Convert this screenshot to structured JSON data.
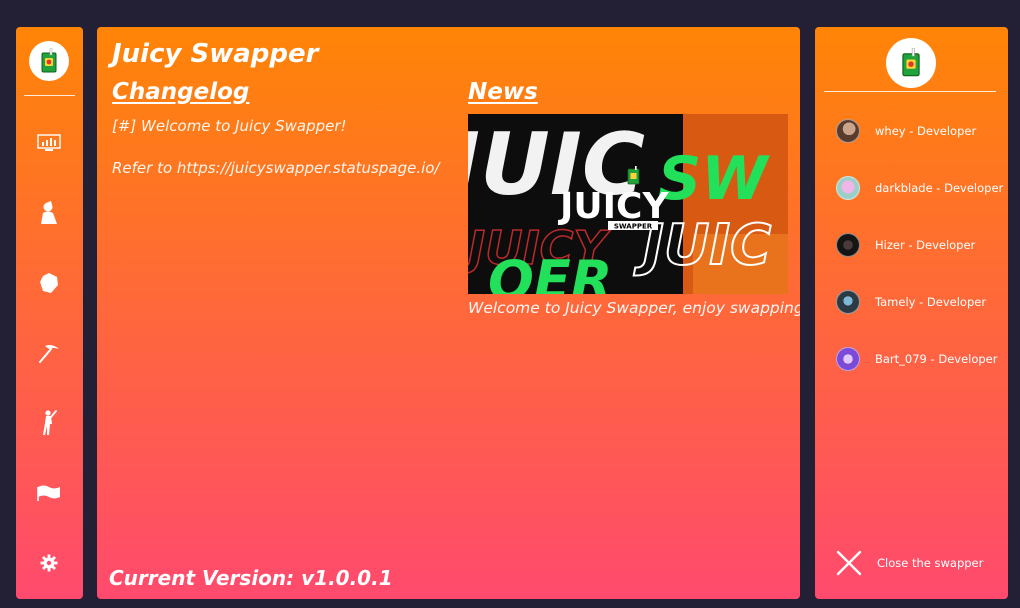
{
  "app": {
    "title": "Juicy Swapper"
  },
  "nav": {
    "items": [
      {
        "icon": "dashboard-icon"
      },
      {
        "icon": "character-icon"
      },
      {
        "icon": "backbling-icon"
      },
      {
        "icon": "pickaxe-icon"
      },
      {
        "icon": "emote-icon"
      },
      {
        "icon": "wrap-flag-icon"
      },
      {
        "icon": "gear-icon"
      }
    ]
  },
  "changelog": {
    "heading": "Changelog",
    "entries": [
      "[#] Welcome to Juicy Swapper!",
      "Refer to https://juicyswapper.statuspage.io/"
    ]
  },
  "news": {
    "heading": "News",
    "banner": {
      "title": "JUICY",
      "subtitle": "SWAPPER"
    },
    "caption": "Welcome to Juicy Swapper, enjoy swapping!"
  },
  "footer": {
    "version": "Current Version: v1.0.0.1"
  },
  "developers": [
    {
      "name": "whey - Developer",
      "avatar_color": "#5a3c2e"
    },
    {
      "name": "darkblade - Developer",
      "avatar_color": "#c9a6d8"
    },
    {
      "name": "Hizer - Developer",
      "avatar_color": "#1e1e1e"
    },
    {
      "name": "Tamely - Developer",
      "avatar_color": "#2c3a44"
    },
    {
      "name": "Bart_079 - Developer",
      "avatar_color": "#7b4ad6"
    }
  ],
  "close": {
    "label": "Close the swapper"
  },
  "theme": {
    "gradient_top": "#ff8506",
    "gradient_bottom": "#ff4a6e",
    "background": "#232036",
    "accent_green": "#22e05a"
  }
}
